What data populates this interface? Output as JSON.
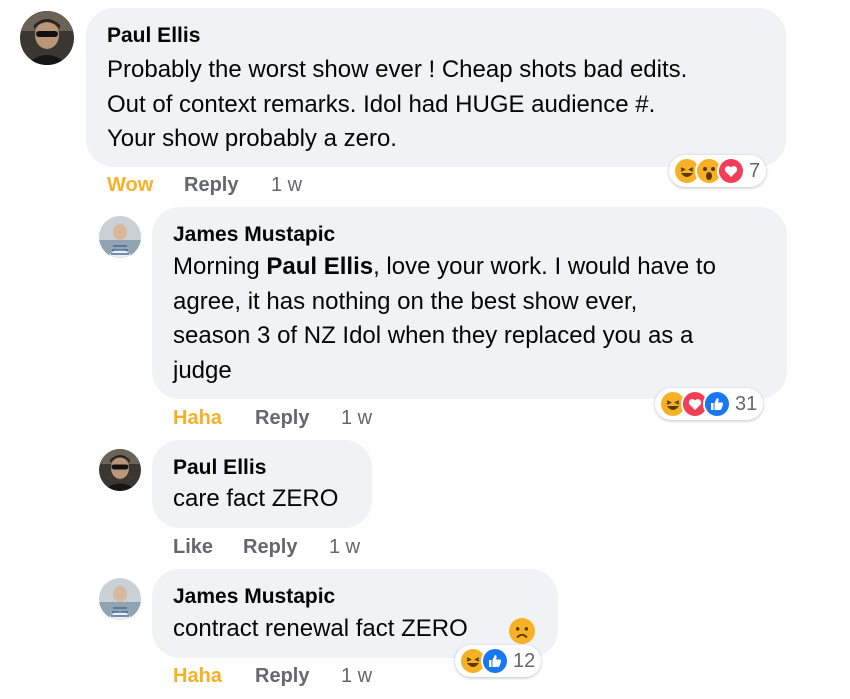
{
  "comments": [
    {
      "author": "Paul Ellis",
      "text_lines": [
        "Probably the worst show ever ! Cheap shots bad edits.",
        "Out of context remarks. Idol had HUGE audience #.",
        "Your show probably a zero."
      ],
      "reaction_action": "Wow",
      "reply_label": "Reply",
      "time": "1 w",
      "reactions": [
        "laughing-emoji",
        "wow-emoji",
        "heart-emoji"
      ],
      "reaction_count": "7"
    },
    {
      "author": "James Mustapic",
      "mention": "Paul Ellis",
      "text_prefix": "Morning ",
      "text_after_mention": ", love your work. I would have to",
      "text_lines": [
        "agree, it has nothing on the best show ever,",
        "season 3 of NZ Idol when they replaced you as a",
        "judge"
      ],
      "reaction_action": "Haha",
      "reply_label": "Reply",
      "time": "1 w",
      "reactions": [
        "laughing-emoji",
        "heart-emoji",
        "like-emoji"
      ],
      "reaction_count": "31"
    },
    {
      "author": "Paul Ellis",
      "text_lines": [
        "care fact ZERO"
      ],
      "reaction_action": "Like",
      "reply_label": "Reply",
      "time": "1 w"
    },
    {
      "author": "James Mustapic",
      "text_lines": [
        "contract renewal fact ZERO"
      ],
      "inline_emoji": "sad-emoji",
      "reaction_action": "Haha",
      "reply_label": "Reply",
      "time": "1 w",
      "reactions": [
        "laughing-emoji",
        "like-emoji"
      ],
      "reaction_count": "12"
    }
  ],
  "colors": {
    "bubble": "#f0f2f5",
    "action_gray": "#65676b",
    "reaction_yellow": "#f7b125",
    "like_blue": "#1877f2",
    "heart_red": "#f33e58"
  }
}
